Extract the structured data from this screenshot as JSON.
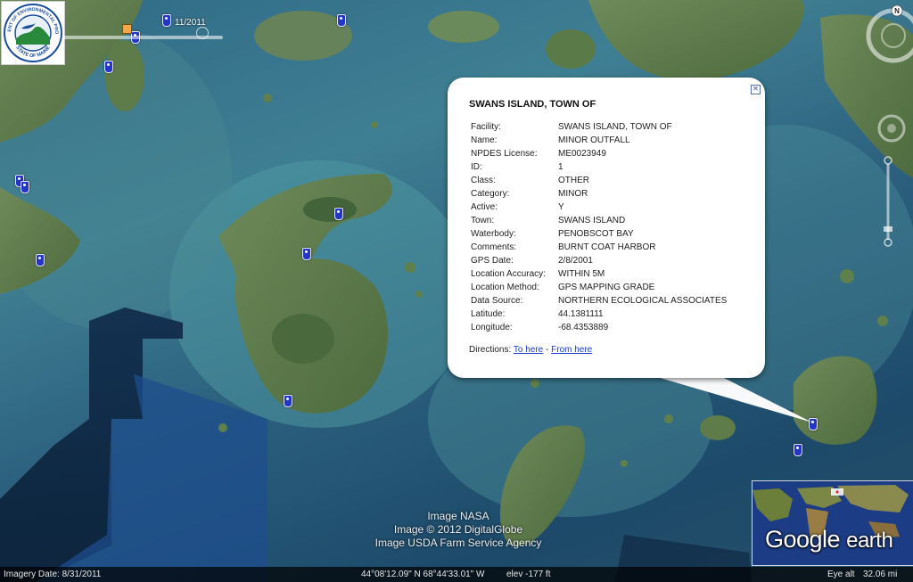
{
  "app": {
    "time_slider_date": "11/2011"
  },
  "logo": {
    "ring_text_top": "DEPARTMENT OF ENVIRONMENTAL PROTECTION",
    "ring_text_bottom": "STATE OF MAINE",
    "colors": {
      "ring": "#1b4e9b",
      "sky": "#e8f1fa",
      "land": "#2a8a3b"
    }
  },
  "balloon": {
    "title": "SWANS ISLAND, TOWN OF",
    "close_icon": "close-x-icon",
    "attributes": [
      {
        "key": "Facility:",
        "value": "SWANS ISLAND, TOWN OF"
      },
      {
        "key": "Name:",
        "value": "MINOR OUTFALL"
      },
      {
        "key": "NPDES License:",
        "value": "ME0023949"
      },
      {
        "key": "ID:",
        "value": "1"
      },
      {
        "key": "Class:",
        "value": "OTHER"
      },
      {
        "key": "Category:",
        "value": "MINOR"
      },
      {
        "key": "Active:",
        "value": "Y"
      },
      {
        "key": "Town:",
        "value": "SWANS ISLAND"
      },
      {
        "key": "Waterbody:",
        "value": "PENOBSCOT BAY"
      },
      {
        "key": "Comments:",
        "value": "BURNT COAT HARBOR"
      },
      {
        "key": "GPS Date:",
        "value": "2/8/2001"
      },
      {
        "key": "Location Accuracy:",
        "value": "WITHIN 5M"
      },
      {
        "key": "Location Method:",
        "value": "GPS MAPPING GRADE"
      },
      {
        "key": "Data Source:",
        "value": "NORTHERN ECOLOGICAL ASSOCIATES"
      },
      {
        "key": "Latitude:",
        "value": "44.1381111"
      },
      {
        "key": "Longitude:",
        "value": "-68.4353889"
      }
    ],
    "directions": {
      "label": "Directions:",
      "to_here": "To here",
      "separator": "-",
      "from_here": "From here"
    }
  },
  "attribution": [
    "Image NASA",
    "Image © 2012 DigitalGlobe",
    "Image USDA Farm Service Agency"
  ],
  "nav": {
    "compass_label": "N"
  },
  "overview": {
    "brand_google": "Google",
    "brand_earth": "earth"
  },
  "status_bar": {
    "imagery_date": "Imagery Date: 8/31/2011",
    "coordinates": "44°08'12.09\" N  68°44'33.01\" W",
    "elevation": "elev  -177 ft",
    "eye_alt_label": "Eye alt",
    "eye_alt_value": "32.06 mi"
  },
  "colors": {
    "water_deep": "#1d4a6a",
    "water_shallow": "#4f97a0",
    "land": "#5a7a48",
    "placemark": "#2436c8",
    "link": "#1a3bd1"
  }
}
